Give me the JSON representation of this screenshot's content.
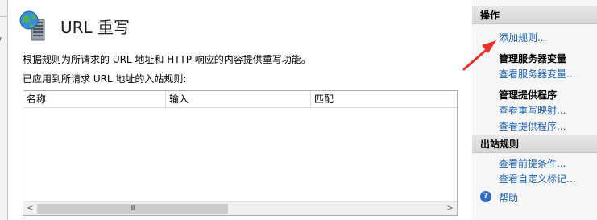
{
  "feature": {
    "title": "URL 重写",
    "description": "根据规则为所请求的 URL 地址和 HTTP 响应的内容提供重写功能。",
    "rules_caption": "已应用到所请求 URL 地址的入站规则:",
    "icon": "globe-server-icon"
  },
  "left_pane": {
    "glyph": "/"
  },
  "rules_table": {
    "columns": [
      "名称",
      "输入",
      "匹配"
    ],
    "rows": [],
    "scroll": {
      "left_arrow": "<",
      "right_arrow": ">",
      "grip": "III"
    }
  },
  "actions_pane": {
    "header": "操作",
    "add_rule": "添加规则...",
    "server_vars_title": "管理服务器变量",
    "view_server_vars": "查看服务器变量...",
    "providers_title": "管理提供程序",
    "view_rewrite_maps": "查看重写映射...",
    "view_providers": "查看提供程序...",
    "outbound_header": "出站规则",
    "view_preconditions": "查看前提条件...",
    "view_custom_tags": "查看自定义标记...",
    "help": "帮助",
    "help_icon_glyph": "?"
  },
  "colors": {
    "link": "#1a5fae",
    "annotation_arrow": "#e8322c",
    "section_header": "#dcdcdc"
  }
}
